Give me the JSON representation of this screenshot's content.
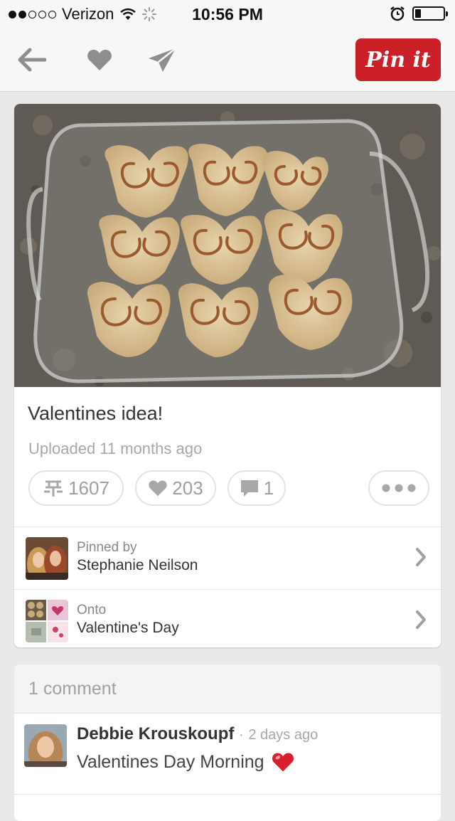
{
  "status_bar": {
    "carrier": "Verizon",
    "time": "10:56 PM",
    "signal_bars_filled": 2,
    "signal_bars_total": 5,
    "battery_level": 0.2
  },
  "toolbar": {
    "back_icon": "back-arrow-icon",
    "like_icon": "heart-icon",
    "send_icon": "paper-plane-icon",
    "pin_it_label": "Pin it",
    "pin_it_color": "#cb2027"
  },
  "pin": {
    "title": "Valentines idea!",
    "uploaded": "Uploaded 11 months ago",
    "stats": {
      "repins": "1607",
      "likes": "203",
      "comments": "1"
    },
    "pinned_by": {
      "label": "Pinned by",
      "name": "Stephanie Neilson"
    },
    "board": {
      "label": "Onto",
      "name": "Valentine's Day"
    }
  },
  "comments": {
    "count_label": "1 comment",
    "items": [
      {
        "author": "Debbie Krouskoupf",
        "separator": "·",
        "time": "2 days ago",
        "text": "Valentines Day Morning"
      }
    ]
  }
}
